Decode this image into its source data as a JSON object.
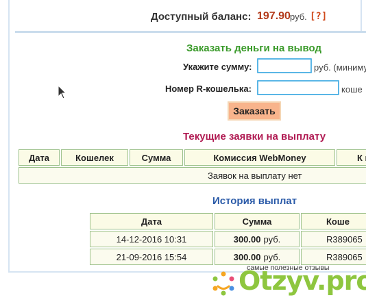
{
  "balance": {
    "label": "Доступный баланс:",
    "amount": "197.90",
    "currency": "руб.",
    "help": "[?]"
  },
  "withdraw": {
    "title": "Заказать деньги на вывод",
    "sum_label": "Укажите сумму:",
    "sum_value": "",
    "sum_hint": "руб. (миниму",
    "wallet_label": "Номер R-кошелька:",
    "wallet_value": "",
    "wallet_hint": "коше",
    "order_button": "Заказать"
  },
  "current_requests": {
    "title": "Текущие заявки на выплату",
    "columns": [
      "Дата",
      "Кошелек",
      "Сумма",
      "Комиссия WebMoney",
      "К п"
    ],
    "empty_text": "Заявок на выплату нет"
  },
  "history": {
    "title": "История выплат",
    "columns": [
      "Дата",
      "Сумма",
      "Коше"
    ],
    "rows": [
      {
        "date": "14-12-2016 10:31",
        "amount": "300.00",
        "currency": "руб.",
        "wallet": "R389065"
      },
      {
        "date": "21-09-2016 15:54",
        "amount": "300.00",
        "currency": "руб.",
        "wallet": "R389065"
      }
    ]
  },
  "watermark": {
    "tagline": "самые полезные отзывы",
    "brand": "Otzyv.pro"
  },
  "colors": {
    "balance_amount": "#b33a1a",
    "withdraw_title": "#3a9a2a",
    "current_title": "#b01a52",
    "history_title": "#2a5aa8",
    "order_button": "#f8b48c",
    "input_border": "#5ab6e6",
    "table_cell": "#fbfbe6",
    "table_border": "#9ec28c",
    "logo_green": "#8ec63f"
  },
  "icons": {
    "cursor": "mouse-pointer-icon",
    "logo": "people-circle-logo-icon"
  }
}
